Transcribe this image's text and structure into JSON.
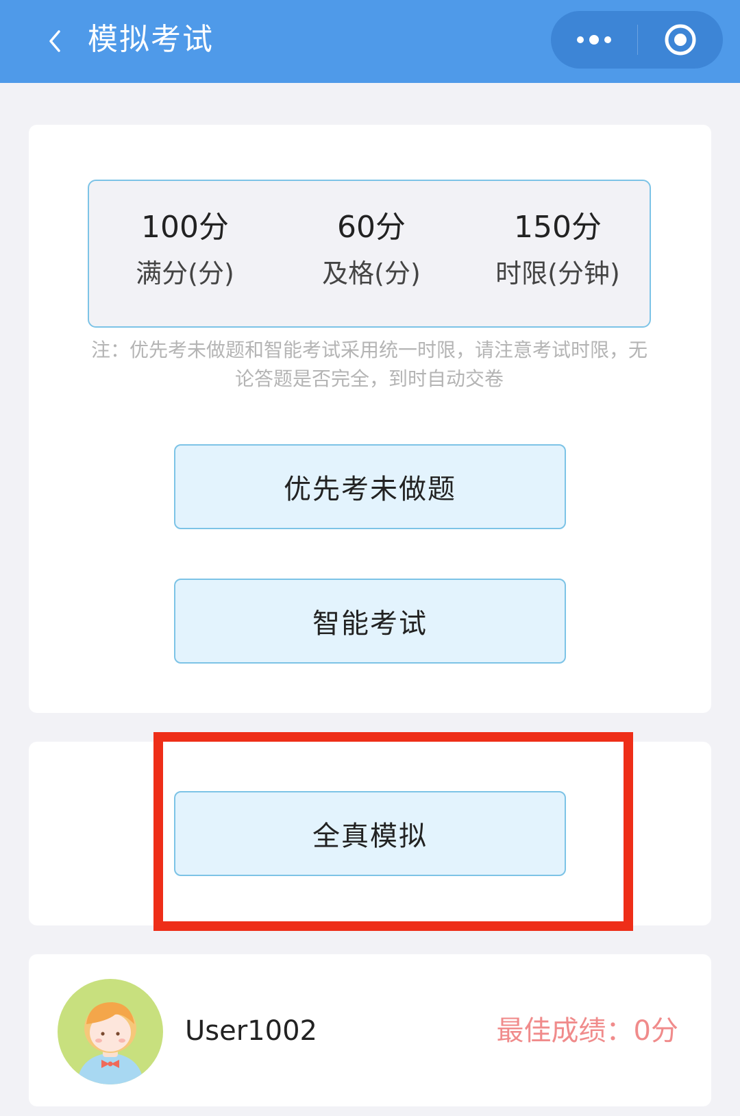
{
  "header": {
    "title": "模拟考试",
    "back_icon": "chevron-left-icon",
    "more_icon": "more-dots-icon",
    "close_icon": "target-circle-icon",
    "background": "#4f9ae9"
  },
  "stats": [
    {
      "value": "100分",
      "label": "满分(分)"
    },
    {
      "value": "60分",
      "label": "及格(分)"
    },
    {
      "value": "150分",
      "label": "时限(分钟)"
    }
  ],
  "note": "注：优先考未做题和智能考试采用统一时限，请注意考试时限，无论答题是否完全，到时自动交卷",
  "buttons": {
    "priority": "优先考未做题",
    "smart": "智能考试",
    "full_sim": "全真模拟"
  },
  "user": {
    "name": "User1002",
    "best_score": "最佳成绩：0分",
    "avatar_icon": "user-avatar-icon"
  },
  "colors": {
    "accent": "#4f9ae9",
    "button_bg": "#e3f3fd",
    "button_border": "#7cc3e6",
    "highlight": "#ee2e18",
    "score": "#f08b8b"
  }
}
